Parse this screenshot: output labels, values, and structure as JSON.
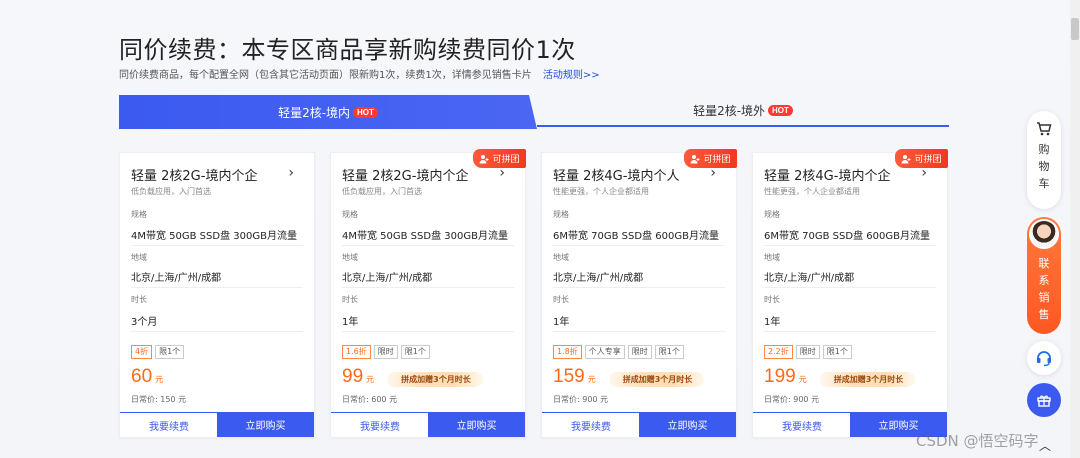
{
  "header": {
    "title": "同价续费：本专区商品享新购续费同价1次",
    "subtitle": "同价续费商品，每个配置全网（包含其它活动页面）限新购1次，续费1次，详情参见销售卡片",
    "rules_link": "活动规则>>"
  },
  "tabs": [
    {
      "label": "轻量2核-境内",
      "badge": "HOT",
      "active": true
    },
    {
      "label": "轻量2核-境外",
      "badge": "HOT",
      "active": false
    }
  ],
  "labels": {
    "spec": "规格",
    "region": "地域",
    "duration": "时长",
    "daily_price_prefix": "日常价:",
    "yuan": "元",
    "renew": "我要续费",
    "buy": "立即购买",
    "group_badge": "可拼团"
  },
  "cards": [
    {
      "title": "轻量 2核2G-境内个企",
      "desc": "低负载应用，入门首选",
      "spec": "4M带宽 50GB SSD盘 300GB月流量",
      "region": "北京/上海/广州/成都",
      "duration": "3个月",
      "discount": "4折",
      "tags": [
        "限1个"
      ],
      "price": "60",
      "promo": "",
      "daily_price": "150 元",
      "group_badge": false
    },
    {
      "title": "轻量 2核2G-境内个企",
      "desc": "低负载应用，入门首选",
      "spec": "4M带宽 50GB SSD盘 300GB月流量",
      "region": "北京/上海/广州/成都",
      "duration": "1年",
      "discount": "1.6折",
      "tags": [
        "限时",
        "限1个"
      ],
      "price": "99",
      "promo": "拼成加赠3个月时长",
      "daily_price": "600 元",
      "group_badge": true
    },
    {
      "title": "轻量 2核4G-境内个人",
      "desc": "性能更强，个人企业都适用",
      "spec": "6M带宽 70GB SSD盘 600GB月流量",
      "region": "北京/上海/广州/成都",
      "duration": "1年",
      "discount": "1.8折",
      "tags": [
        "个人专享",
        "限时",
        "限1个"
      ],
      "price": "159",
      "promo": "拼成加赠3个月时长",
      "daily_price": "900 元",
      "group_badge": true
    },
    {
      "title": "轻量 2核4G-境内个企",
      "desc": "性能更强，个人企业都适用",
      "spec": "6M带宽 70GB SSD盘 600GB月流量",
      "region": "北京/上海/广州/成都",
      "duration": "1年",
      "discount": "2.2折",
      "tags": [
        "限时",
        "限1个"
      ],
      "price": "199",
      "promo": "拼成加赠3个月时长",
      "daily_price": "900 元",
      "group_badge": true
    }
  ],
  "sidebar": {
    "cart_label": [
      "购",
      "物",
      "车"
    ],
    "contact_label": [
      "联",
      "系",
      "销",
      "售"
    ]
  },
  "watermark": "CSDN @悟空码字",
  "colors": {
    "primary": "#3b5af0",
    "price": "#ff6a1a",
    "badge": "#f0391f",
    "contact": "#ff5722"
  }
}
